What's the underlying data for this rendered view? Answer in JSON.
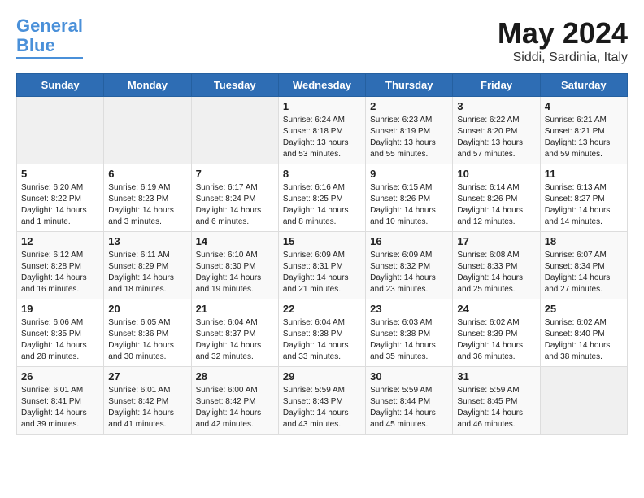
{
  "header": {
    "logo_line1": "General",
    "logo_line2": "Blue",
    "month": "May 2024",
    "location": "Siddi, Sardinia, Italy"
  },
  "weekdays": [
    "Sunday",
    "Monday",
    "Tuesday",
    "Wednesday",
    "Thursday",
    "Friday",
    "Saturday"
  ],
  "weeks": [
    [
      {
        "day": "",
        "sunrise": "",
        "sunset": "",
        "daylight": ""
      },
      {
        "day": "",
        "sunrise": "",
        "sunset": "",
        "daylight": ""
      },
      {
        "day": "",
        "sunrise": "",
        "sunset": "",
        "daylight": ""
      },
      {
        "day": "1",
        "sunrise": "Sunrise: 6:24 AM",
        "sunset": "Sunset: 8:18 PM",
        "daylight": "Daylight: 13 hours and 53 minutes."
      },
      {
        "day": "2",
        "sunrise": "Sunrise: 6:23 AM",
        "sunset": "Sunset: 8:19 PM",
        "daylight": "Daylight: 13 hours and 55 minutes."
      },
      {
        "day": "3",
        "sunrise": "Sunrise: 6:22 AM",
        "sunset": "Sunset: 8:20 PM",
        "daylight": "Daylight: 13 hours and 57 minutes."
      },
      {
        "day": "4",
        "sunrise": "Sunrise: 6:21 AM",
        "sunset": "Sunset: 8:21 PM",
        "daylight": "Daylight: 13 hours and 59 minutes."
      }
    ],
    [
      {
        "day": "5",
        "sunrise": "Sunrise: 6:20 AM",
        "sunset": "Sunset: 8:22 PM",
        "daylight": "Daylight: 14 hours and 1 minute."
      },
      {
        "day": "6",
        "sunrise": "Sunrise: 6:19 AM",
        "sunset": "Sunset: 8:23 PM",
        "daylight": "Daylight: 14 hours and 3 minutes."
      },
      {
        "day": "7",
        "sunrise": "Sunrise: 6:17 AM",
        "sunset": "Sunset: 8:24 PM",
        "daylight": "Daylight: 14 hours and 6 minutes."
      },
      {
        "day": "8",
        "sunrise": "Sunrise: 6:16 AM",
        "sunset": "Sunset: 8:25 PM",
        "daylight": "Daylight: 14 hours and 8 minutes."
      },
      {
        "day": "9",
        "sunrise": "Sunrise: 6:15 AM",
        "sunset": "Sunset: 8:26 PM",
        "daylight": "Daylight: 14 hours and 10 minutes."
      },
      {
        "day": "10",
        "sunrise": "Sunrise: 6:14 AM",
        "sunset": "Sunset: 8:26 PM",
        "daylight": "Daylight: 14 hours and 12 minutes."
      },
      {
        "day": "11",
        "sunrise": "Sunrise: 6:13 AM",
        "sunset": "Sunset: 8:27 PM",
        "daylight": "Daylight: 14 hours and 14 minutes."
      }
    ],
    [
      {
        "day": "12",
        "sunrise": "Sunrise: 6:12 AM",
        "sunset": "Sunset: 8:28 PM",
        "daylight": "Daylight: 14 hours and 16 minutes."
      },
      {
        "day": "13",
        "sunrise": "Sunrise: 6:11 AM",
        "sunset": "Sunset: 8:29 PM",
        "daylight": "Daylight: 14 hours and 18 minutes."
      },
      {
        "day": "14",
        "sunrise": "Sunrise: 6:10 AM",
        "sunset": "Sunset: 8:30 PM",
        "daylight": "Daylight: 14 hours and 19 minutes."
      },
      {
        "day": "15",
        "sunrise": "Sunrise: 6:09 AM",
        "sunset": "Sunset: 8:31 PM",
        "daylight": "Daylight: 14 hours and 21 minutes."
      },
      {
        "day": "16",
        "sunrise": "Sunrise: 6:09 AM",
        "sunset": "Sunset: 8:32 PM",
        "daylight": "Daylight: 14 hours and 23 minutes."
      },
      {
        "day": "17",
        "sunrise": "Sunrise: 6:08 AM",
        "sunset": "Sunset: 8:33 PM",
        "daylight": "Daylight: 14 hours and 25 minutes."
      },
      {
        "day": "18",
        "sunrise": "Sunrise: 6:07 AM",
        "sunset": "Sunset: 8:34 PM",
        "daylight": "Daylight: 14 hours and 27 minutes."
      }
    ],
    [
      {
        "day": "19",
        "sunrise": "Sunrise: 6:06 AM",
        "sunset": "Sunset: 8:35 PM",
        "daylight": "Daylight: 14 hours and 28 minutes."
      },
      {
        "day": "20",
        "sunrise": "Sunrise: 6:05 AM",
        "sunset": "Sunset: 8:36 PM",
        "daylight": "Daylight: 14 hours and 30 minutes."
      },
      {
        "day": "21",
        "sunrise": "Sunrise: 6:04 AM",
        "sunset": "Sunset: 8:37 PM",
        "daylight": "Daylight: 14 hours and 32 minutes."
      },
      {
        "day": "22",
        "sunrise": "Sunrise: 6:04 AM",
        "sunset": "Sunset: 8:38 PM",
        "daylight": "Daylight: 14 hours and 33 minutes."
      },
      {
        "day": "23",
        "sunrise": "Sunrise: 6:03 AM",
        "sunset": "Sunset: 8:38 PM",
        "daylight": "Daylight: 14 hours and 35 minutes."
      },
      {
        "day": "24",
        "sunrise": "Sunrise: 6:02 AM",
        "sunset": "Sunset: 8:39 PM",
        "daylight": "Daylight: 14 hours and 36 minutes."
      },
      {
        "day": "25",
        "sunrise": "Sunrise: 6:02 AM",
        "sunset": "Sunset: 8:40 PM",
        "daylight": "Daylight: 14 hours and 38 minutes."
      }
    ],
    [
      {
        "day": "26",
        "sunrise": "Sunrise: 6:01 AM",
        "sunset": "Sunset: 8:41 PM",
        "daylight": "Daylight: 14 hours and 39 minutes."
      },
      {
        "day": "27",
        "sunrise": "Sunrise: 6:01 AM",
        "sunset": "Sunset: 8:42 PM",
        "daylight": "Daylight: 14 hours and 41 minutes."
      },
      {
        "day": "28",
        "sunrise": "Sunrise: 6:00 AM",
        "sunset": "Sunset: 8:42 PM",
        "daylight": "Daylight: 14 hours and 42 minutes."
      },
      {
        "day": "29",
        "sunrise": "Sunrise: 5:59 AM",
        "sunset": "Sunset: 8:43 PM",
        "daylight": "Daylight: 14 hours and 43 minutes."
      },
      {
        "day": "30",
        "sunrise": "Sunrise: 5:59 AM",
        "sunset": "Sunset: 8:44 PM",
        "daylight": "Daylight: 14 hours and 45 minutes."
      },
      {
        "day": "31",
        "sunrise": "Sunrise: 5:59 AM",
        "sunset": "Sunset: 8:45 PM",
        "daylight": "Daylight: 14 hours and 46 minutes."
      },
      {
        "day": "",
        "sunrise": "",
        "sunset": "",
        "daylight": ""
      }
    ]
  ]
}
